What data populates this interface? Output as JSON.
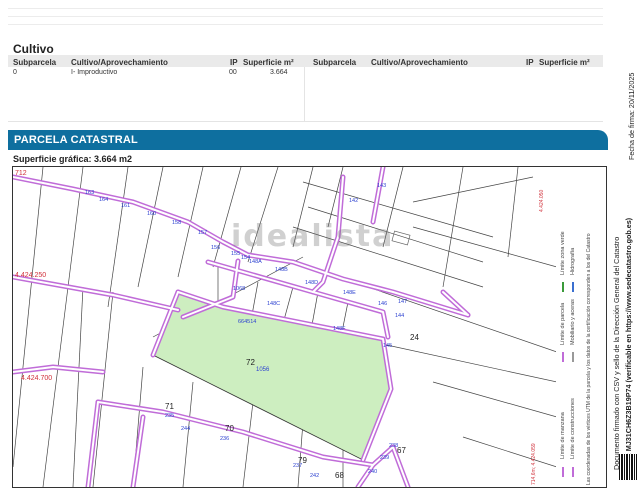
{
  "cultivo": {
    "title": "Cultivo",
    "headers": {
      "subparcela": "Subparcela",
      "cultivo_aprovechamiento": "Cultivo/Aprovechamiento",
      "ip": "IP",
      "superficie": "Superficie m²"
    },
    "row": {
      "subparcela": "0",
      "cultivo": "I- Improductivo",
      "ip": "00",
      "superficie": "3.664"
    }
  },
  "parcela": {
    "banner": "PARCELA CATASTRAL",
    "superficie_grafica": "Superficie gráfica: 3.664 m2"
  },
  "map": {
    "watermark": "idealista",
    "coords": {
      "top_left": "712",
      "mid_left": "4.424.250",
      "low_left": "4.424.700",
      "right_top": "4.424.050"
    },
    "parcel_labels": [
      "72",
      "1056",
      "24",
      "71",
      "70",
      "79",
      "68",
      "67"
    ],
    "boundary_labels": [
      "163",
      "164",
      "161",
      "160",
      "158",
      "157",
      "156",
      "155",
      "154",
      "148A",
      "148B",
      "148C",
      "148D",
      "148E",
      "146",
      "147",
      "148F",
      "1068",
      "145",
      "144",
      "142",
      "143",
      "235",
      "244",
      "236",
      "237",
      "242",
      "240",
      "239",
      "238",
      "664514"
    ],
    "footer_label": "714,6m; 4.424.059"
  },
  "legend": {
    "items": [
      "Límite de manzana",
      "Límite de parcela",
      "Límite de construcciones",
      "Mobiliario y aceras",
      "Límite zona verde",
      "Hidrografía"
    ],
    "note": "Las coordenadas de los vértices UTM de la parcela y los datos de la certificación corresponden a los del Catastro"
  },
  "sidebar": {
    "line1": "Documento firmado con CSV y sello de la Dirección General del Catastro",
    "line2": "CSV: MJ31CH6Z3B19P74 (verificable en https://www.sedecatastro.gob.es)",
    "fecha": "Fecha de firma: 20/11/2025"
  },
  "colors": {
    "banner": "#0e6f9f",
    "parcel_fill": "#cdeec0",
    "boundary": "#c06cd8",
    "boundary_inner": "#ffffff",
    "label_blue": "#2a3fd0",
    "label_red": "#d0303a"
  }
}
